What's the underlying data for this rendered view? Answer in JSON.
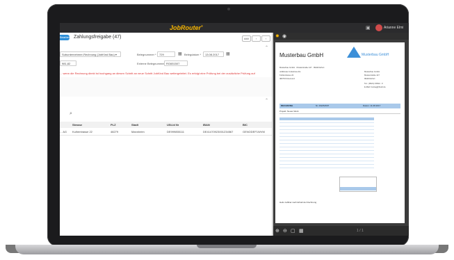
{
  "app": {
    "logo": "JobRouter",
    "user_name": "Arianne Elmi"
  },
  "left_panel": {
    "step_label": "Bearbeiten",
    "title": "Zahlungsfreigabe (47)",
    "buttons": [
      "### ",
      "‹",
      "›"
    ],
    "form": {
      "type_select": "Subunternehmer-Rechnung (JobKind Bau) ▾",
      "amount": "981,82",
      "belegnummer_label": "Belegnummer *",
      "belegnummer_value": "729",
      "belegdatum_label": "Belegdatum *",
      "belegdatum_value": "13.08.2017",
      "extern_label": "Externe Belegnummer",
      "extern_value": "RG651507"
    },
    "warning": "... wenn die Rechnung direkt ist hochgang an diesen Schritt an neue Schritt JobKind Bau weitergeleitet. Es erfolgt eine Prüfung bei der zusätzliche Prüfung auf",
    "table": {
      "headers": [
        "",
        "Strasse",
        "PLZ",
        "Stadt",
        "USt-Id Nr",
        "IBAN",
        "BIC"
      ],
      "rows": [
        [
          "... AG",
          "Kulhentrasse 22",
          "48279",
          "Mannheim",
          "DE999855111",
          "DE41470923001234567",
          "GENODEF1WVM"
        ]
      ]
    }
  },
  "viewer": {
    "invoice": {
      "title": "Musterbau GmbH",
      "brand": "Musterbau GmbH",
      "sender": "Musterbau GmbH · Musterstraße 147 · 99423 Erfurt",
      "recipient": [
        "JobRouter Industries AG",
        "Kuhlentrasse 22",
        "48279 Kitzemond"
      ],
      "company": [
        "Musterbau GmbH",
        "Musterstraße 147",
        "99423 Erfurt"
      ],
      "contact": [
        "Tel.: (0621) 43642 - 0",
        "E-Mail: bunteg@bsdc.de"
      ],
      "band_label": "RECHNUNG",
      "band_number": "Nr. RG651507",
      "band_date": "Datum: 11.08.2017",
      "project": "Projekt: Neues Werk",
      "greeting": "Heilo zahlbar nach Erhalt der Rechnung"
    },
    "page_indicator": "1 / 1"
  }
}
